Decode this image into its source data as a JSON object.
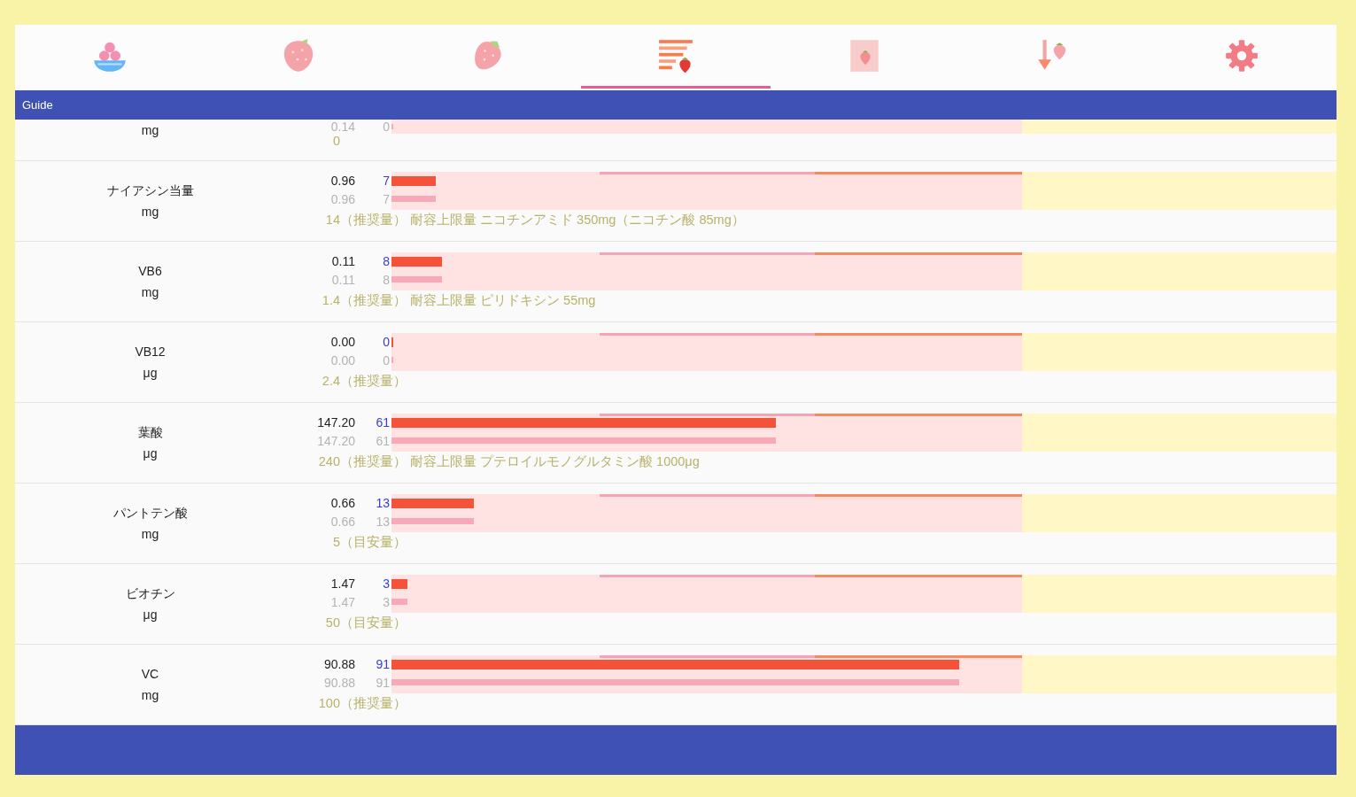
{
  "tabs": [
    {
      "selected": false
    },
    {
      "selected": false
    },
    {
      "selected": false
    },
    {
      "selected": true
    },
    {
      "selected": false
    },
    {
      "selected": false
    },
    {
      "selected": false
    }
  ],
  "header": {
    "title": "Guide"
  },
  "nutrients": [
    {
      "kind": "partial",
      "unit": "mg",
      "bars": [
        {
          "kind": "secondary",
          "value": "0.14",
          "percent": "0",
          "level": 0
        }
      ],
      "recommended": "0"
    },
    {
      "kind": "full",
      "name": "ナイアシン当量",
      "unit": "mg",
      "bars": [
        {
          "kind": "primary",
          "value": "0.96",
          "percent": "7",
          "level": 0.07
        },
        {
          "kind": "secondary",
          "value": "0.96",
          "percent": "7",
          "level": 0.07
        }
      ],
      "recommended": "14",
      "note": "（推奨量） 耐容上限量 ニコチンアミド 350mg（ニコチン酸 85mg）"
    },
    {
      "kind": "full",
      "name": "VB6",
      "unit": "mg",
      "bars": [
        {
          "kind": "primary",
          "value": "0.11",
          "percent": "8",
          "level": 0.08
        },
        {
          "kind": "secondary",
          "value": "0.11",
          "percent": "8",
          "level": 0.08
        }
      ],
      "recommended": "1.4",
      "note": "（推奨量） 耐容上限量 ピリドキシン 55mg"
    },
    {
      "kind": "full",
      "name": "VB12",
      "unit": "μg",
      "bars": [
        {
          "kind": "primary",
          "value": "0.00",
          "percent": "0",
          "level": 0
        },
        {
          "kind": "secondary",
          "value": "0.00",
          "percent": "0",
          "level": 0
        }
      ],
      "recommended": "2.4",
      "note": "（推奨量）"
    },
    {
      "kind": "full",
      "name": "葉酸",
      "unit": "μg",
      "bars": [
        {
          "kind": "primary",
          "value": "147.20",
          "percent": "61",
          "level": 0.61
        },
        {
          "kind": "secondary",
          "value": "147.20",
          "percent": "61",
          "level": 0.61
        }
      ],
      "recommended": "240",
      "note": "（推奨量） 耐容上限量 プテロイルモノグルタミン酸 1000μg"
    },
    {
      "kind": "full",
      "name": "パントテン酸",
      "unit": "mg",
      "bars": [
        {
          "kind": "primary",
          "value": "0.66",
          "percent": "13",
          "level": 0.13
        },
        {
          "kind": "secondary",
          "value": "0.66",
          "percent": "13",
          "level": 0.13
        }
      ],
      "recommended": "5",
      "note": "（目安量）"
    },
    {
      "kind": "full",
      "name": "ビオチン",
      "unit": "μg",
      "bars": [
        {
          "kind": "primary",
          "value": "1.47",
          "percent": "3",
          "level": 0.025
        },
        {
          "kind": "secondary",
          "value": "1.47",
          "percent": "3",
          "level": 0.025
        }
      ],
      "recommended": "50",
      "note": "（目安量）"
    },
    {
      "kind": "full",
      "name": "VC",
      "unit": "mg",
      "bars": [
        {
          "kind": "primary",
          "value": "90.88",
          "percent": "91",
          "level": 0.9
        },
        {
          "kind": "secondary",
          "value": "90.88",
          "percent": "91",
          "level": 0.9
        }
      ],
      "recommended": "100",
      "note": "（推奨量）"
    }
  ]
}
